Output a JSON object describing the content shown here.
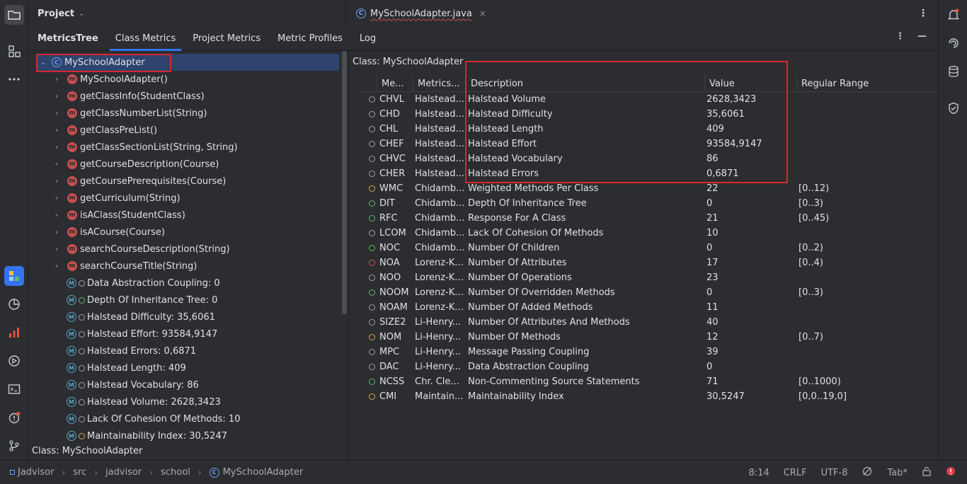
{
  "colors": {
    "accent": "#3574f0",
    "selection": "#2e436e",
    "highlight": "#d9272e",
    "method": "#c94f4f",
    "dot_orange": "#d5a24a",
    "dot_green": "#5fb865",
    "dot_red": "#d9534f",
    "dot_gray": "#9da0a8"
  },
  "project_header": {
    "title": "Project",
    "chevron": "chevron-down-icon"
  },
  "editor": {
    "tab_label": "MySchoolAdapter.java",
    "close": "×",
    "more": "⋮"
  },
  "tool_tabs": [
    {
      "label": "MetricsTree",
      "active": false
    },
    {
      "label": "Class Metrics",
      "active": true
    },
    {
      "label": "Project Metrics",
      "active": false
    },
    {
      "label": "Metric Profiles",
      "active": false
    },
    {
      "label": "Log",
      "active": false
    }
  ],
  "tool_actions": {
    "more": "⋮",
    "minimize": "—"
  },
  "tree": {
    "root": {
      "label": "MySchoolAdapter",
      "icon": "class-icon"
    },
    "methods": [
      "MySchoolAdapter()",
      "getClassInfo(StudentClass)",
      "getClassNumberList(String)",
      "getClassPreList()",
      "getClassSectionList(String, String)",
      "getCourseDescription(Course)",
      "getCoursePrerequisites(Course)",
      "getCurriculum(String)",
      "isAClass(StudentClass)",
      "isACourse(Course)",
      "searchCourseDescription(String)",
      "searchCourseTitle(String)"
    ],
    "metrics": [
      {
        "label": "Data Abstraction Coupling: 0",
        "dot": "gray"
      },
      {
        "label": "Depth Of Inheritance Tree: 0",
        "dot": "green"
      },
      {
        "label": "Halstead Difficulty: 35,6061",
        "dot": "gray"
      },
      {
        "label": "Halstead Effort: 93584,9147",
        "dot": "gray"
      },
      {
        "label": "Halstead Errors: 0,6871",
        "dot": "gray"
      },
      {
        "label": "Halstead Length: 409",
        "dot": "gray"
      },
      {
        "label": "Halstead Vocabulary: 86",
        "dot": "gray"
      },
      {
        "label": "Halstead Volume: 2628,3423",
        "dot": "gray"
      },
      {
        "label": "Lack Of Cohesion Of Methods: 10",
        "dot": "gray"
      },
      {
        "label": "Maintainability Index: 30,5247",
        "dot": "orange"
      }
    ],
    "status": "Class: MySchoolAdapter"
  },
  "table": {
    "title": "Class: MySchoolAdapter",
    "columns": [
      "Me...",
      "Metrics...",
      "Description",
      "Value",
      "Regular Range"
    ],
    "rows": [
      {
        "dot": "gray",
        "metric": "CHVL",
        "set": "Halstead...",
        "desc": "Halstead Volume",
        "value": "2628,3423",
        "range": ""
      },
      {
        "dot": "gray",
        "metric": "CHD",
        "set": "Halstead...",
        "desc": "Halstead Difficulty",
        "value": "35,6061",
        "range": ""
      },
      {
        "dot": "gray",
        "metric": "CHL",
        "set": "Halstead...",
        "desc": "Halstead Length",
        "value": "409",
        "range": ""
      },
      {
        "dot": "gray",
        "metric": "CHEF",
        "set": "Halstead...",
        "desc": "Halstead Effort",
        "value": "93584,9147",
        "range": ""
      },
      {
        "dot": "gray",
        "metric": "CHVC",
        "set": "Halstead...",
        "desc": "Halstead Vocabulary",
        "value": "86",
        "range": ""
      },
      {
        "dot": "gray",
        "metric": "CHER",
        "set": "Halstead...",
        "desc": "Halstead Errors",
        "value": "0,6871",
        "range": ""
      },
      {
        "dot": "orange",
        "metric": "WMC",
        "set": "Chidamb...",
        "desc": "Weighted Methods Per Class",
        "value": "22",
        "range": "[0..12)"
      },
      {
        "dot": "green",
        "metric": "DIT",
        "set": "Chidamb...",
        "desc": "Depth Of Inheritance Tree",
        "value": "0",
        "range": "[0..3)"
      },
      {
        "dot": "green",
        "metric": "RFC",
        "set": "Chidamb...",
        "desc": "Response For A Class",
        "value": "21",
        "range": "[0..45)"
      },
      {
        "dot": "gray",
        "metric": "LCOM",
        "set": "Chidamb...",
        "desc": "Lack Of Cohesion Of Methods",
        "value": "10",
        "range": ""
      },
      {
        "dot": "green",
        "metric": "NOC",
        "set": "Chidamb...",
        "desc": "Number Of Children",
        "value": "0",
        "range": "[0..2)"
      },
      {
        "dot": "red",
        "metric": "NOA",
        "set": "Lorenz-K...",
        "desc": "Number Of Attributes",
        "value": "17",
        "range": "[0..4)"
      },
      {
        "dot": "gray",
        "metric": "NOO",
        "set": "Lorenz-K...",
        "desc": "Number Of Operations",
        "value": "23",
        "range": ""
      },
      {
        "dot": "green",
        "metric": "NOOM",
        "set": "Lorenz-K...",
        "desc": "Number Of Overridden Methods",
        "value": "0",
        "range": "[0..3)"
      },
      {
        "dot": "gray",
        "metric": "NOAM",
        "set": "Lorenz-K...",
        "desc": "Number Of Added Methods",
        "value": "11",
        "range": ""
      },
      {
        "dot": "gray",
        "metric": "SIZE2",
        "set": "Li-Henry...",
        "desc": "Number Of Attributes And Methods",
        "value": "40",
        "range": ""
      },
      {
        "dot": "orange",
        "metric": "NOM",
        "set": "Li-Henry...",
        "desc": "Number Of Methods",
        "value": "12",
        "range": "[0..7)"
      },
      {
        "dot": "gray",
        "metric": "MPC",
        "set": "Li-Henry...",
        "desc": "Message Passing Coupling",
        "value": "39",
        "range": ""
      },
      {
        "dot": "gray",
        "metric": "DAC",
        "set": "Li-Henry...",
        "desc": "Data Abstraction Coupling",
        "value": "0",
        "range": ""
      },
      {
        "dot": "green",
        "metric": "NCSS",
        "set": "Chr. Cle...",
        "desc": "Non-Commenting Source Statements",
        "value": "71",
        "range": "[0..1000)"
      },
      {
        "dot": "orange",
        "metric": "CMI",
        "set": "Maintain...",
        "desc": "Maintainability Index",
        "value": "30,5247",
        "range": "[0,0..19,0]"
      }
    ]
  },
  "breadcrumb": [
    "Jadvisor",
    "src",
    "jadvisor",
    "school",
    "MySchoolAdapter"
  ],
  "status_right": {
    "position": "8:14",
    "line_sep": "CRLF",
    "encoding": "UTF-8",
    "indent": "Tab*"
  }
}
